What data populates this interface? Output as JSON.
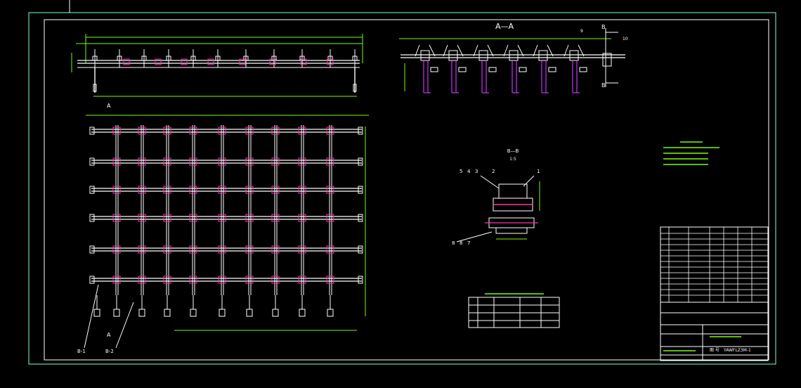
{
  "views": {
    "section_aa": {
      "title": "A—A"
    },
    "section_bb": {
      "title": "B—B",
      "scale": "1:5"
    },
    "section_markers": [
      "A",
      "A",
      "B",
      "B"
    ],
    "bottom_callouts": [
      "B-1",
      "B-2"
    ],
    "bb_callouts_top": [
      "5",
      "4",
      "3",
      "2",
      "1"
    ],
    "bb_callouts_bottom": [
      "8",
      "8",
      "7"
    ],
    "aa_callouts": [
      "9",
      "10"
    ]
  },
  "title_block": {
    "drawing_no_label": "图 号",
    "drawing_no": "YAWFLZ3M-1"
  },
  "colors": {
    "background": "#000000",
    "frame": "#7fffd4",
    "dimension": "#7cfc00",
    "geometry": "#ffffff",
    "highlight": "#ff33aa",
    "purple": "#cc33ff",
    "callout": "#ffffff"
  }
}
